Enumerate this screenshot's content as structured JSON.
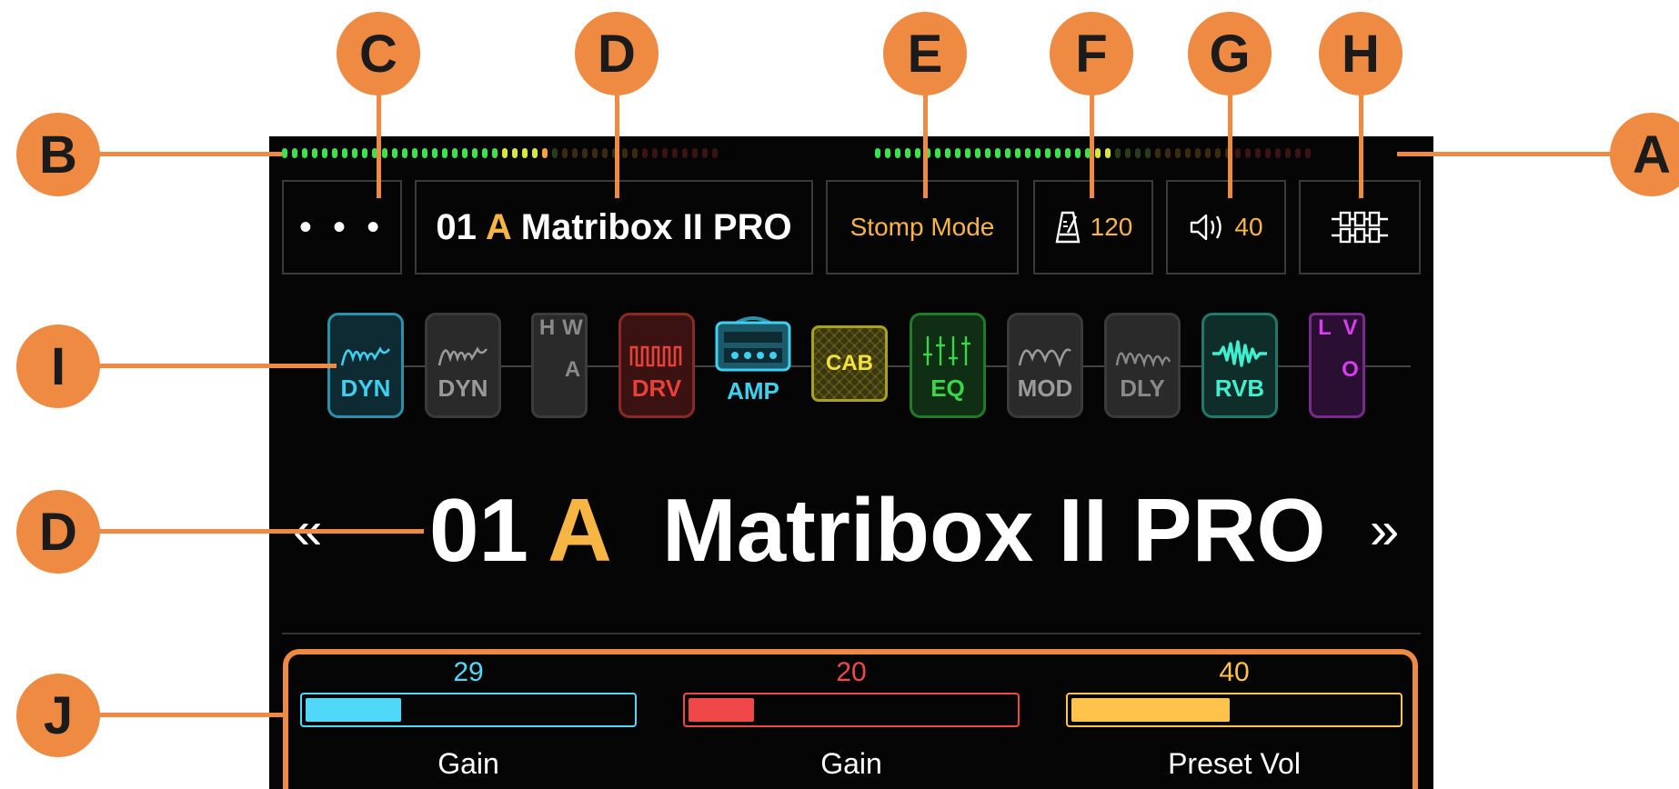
{
  "top_bar": {
    "menu_label": "• • •",
    "preset_number": "01",
    "preset_letter": "A",
    "preset_name": "Matribox II PRO",
    "mode_label": "Stomp Mode",
    "tempo_value": "120",
    "volume_value": "40"
  },
  "chain": [
    {
      "label": "DYN",
      "state": "on",
      "color": "#3fd0f0",
      "icon": "compressor-wave-icon"
    },
    {
      "label": "DYN",
      "state": "off",
      "color": "#8a8a8a",
      "icon": "compressor-wave-icon"
    },
    {
      "label": "W A H",
      "state": "off",
      "color": "#6a6a6a",
      "icon": "wah-pedal-icon"
    },
    {
      "label": "DRV",
      "state": "on",
      "color": "#e8413a",
      "icon": "square-wave-icon"
    },
    {
      "label": "AMP",
      "state": "on",
      "color": "#3fd0f0",
      "icon": "amp-head-icon"
    },
    {
      "label": "CAB",
      "state": "on",
      "color": "#f2e23a",
      "icon": "cabinet-icon"
    },
    {
      "label": "EQ",
      "state": "on",
      "color": "#39d64a",
      "icon": "eq-sliders-icon"
    },
    {
      "label": "MOD",
      "state": "off",
      "color": "#8a8a8a",
      "icon": "modulation-wave-icon"
    },
    {
      "label": "DLY",
      "state": "off",
      "color": "#8a8a8a",
      "icon": "delay-wave-icon"
    },
    {
      "label": "RVB",
      "state": "on",
      "color": "#3ff0d0",
      "icon": "reverb-wave-icon"
    },
    {
      "label": "V O L",
      "state": "on",
      "color": "#c83ee0",
      "icon": "volume-pedal-icon"
    }
  ],
  "big_title": {
    "number": "01",
    "letter": "A",
    "name": "Matribox II PRO",
    "prev_label": "«",
    "next_label": "»"
  },
  "knobs": [
    {
      "label": "Gain",
      "value": "29",
      "level": 0.29,
      "color": "#4fd8f8"
    },
    {
      "label": "Gain",
      "value": "20",
      "level": 0.2,
      "color": "#f04848"
    },
    {
      "label": "Preset Vol",
      "value": "40",
      "level": 0.48,
      "color": "#ffc24a"
    }
  ],
  "callouts": [
    "A",
    "B",
    "C",
    "D",
    "E",
    "F",
    "G",
    "H",
    "I",
    "D",
    "J"
  ],
  "meters": {
    "left_active": 27,
    "right_active": 24,
    "total_per_meter": 44
  },
  "colors": {
    "callout": "#ef8a43",
    "accent": "#f7b643",
    "screen": "#050505"
  }
}
